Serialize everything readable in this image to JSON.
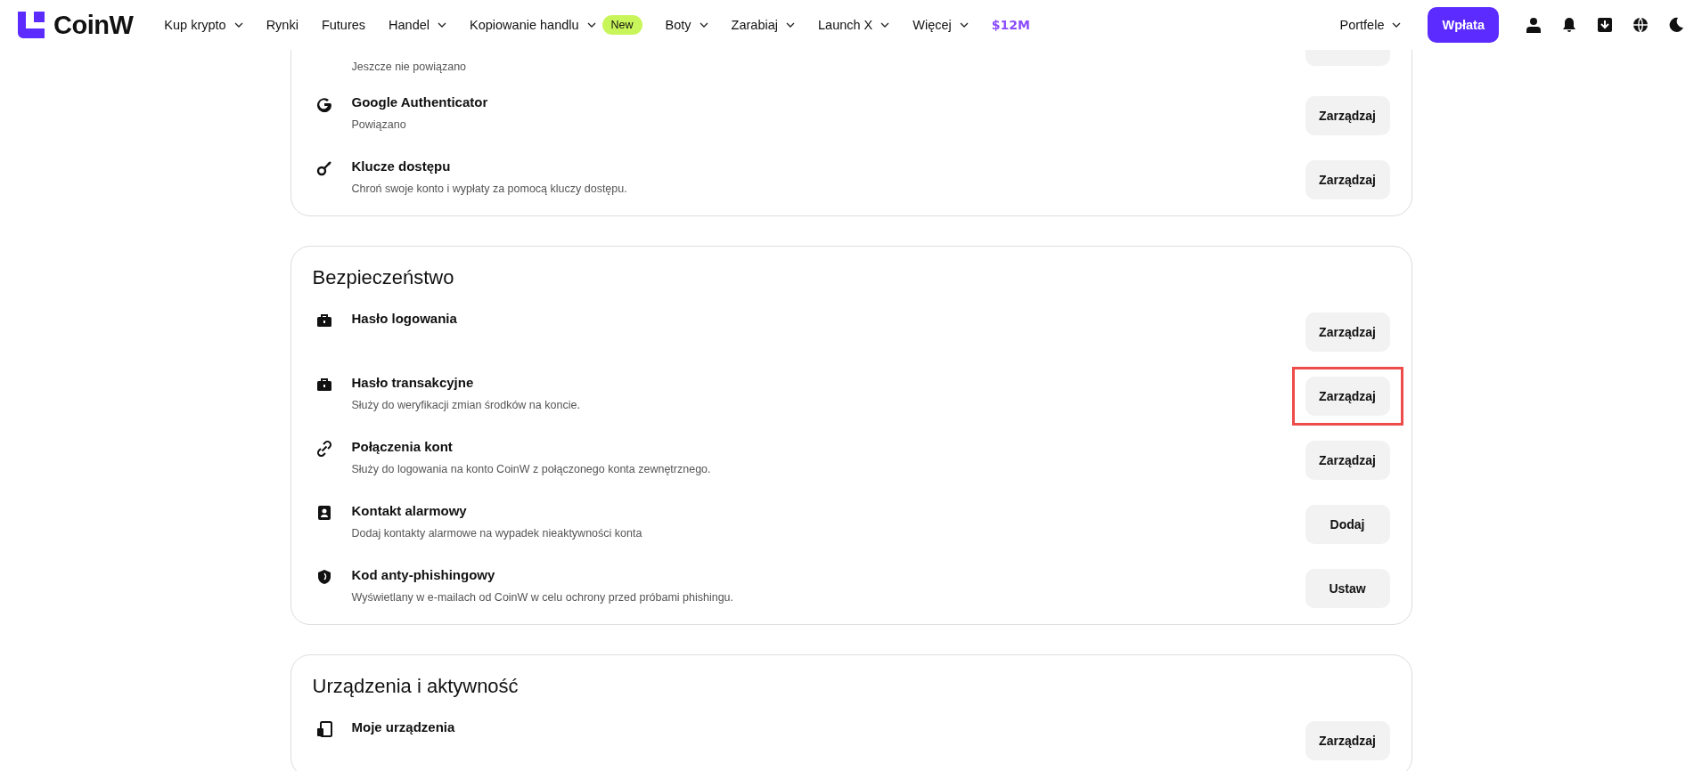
{
  "header": {
    "logo": "CoinW",
    "nav": [
      {
        "label": "Kup krypto",
        "caret": true
      },
      {
        "label": "Rynki",
        "caret": false
      },
      {
        "label": "Futures",
        "caret": false
      },
      {
        "label": "Handel",
        "caret": true
      },
      {
        "label": "Kopiowanie handlu",
        "caret": true,
        "badge": "New"
      },
      {
        "label": "Boty",
        "caret": true
      },
      {
        "label": "Zarabiaj",
        "caret": true
      },
      {
        "label": "Launch X",
        "caret": true
      },
      {
        "label": "Więcej",
        "caret": true
      }
    ],
    "promo": "$12M",
    "wallets": {
      "label": "Portfele",
      "caret": true
    },
    "deposit": "Wpłata"
  },
  "sections": [
    {
      "rows": [
        {
          "kind": "partial",
          "subtitle": "Jeszcze nie powiązano"
        },
        {
          "kind": "google",
          "title": "Google Authenticator",
          "subtitle": "Powiązano",
          "button": "Zarządzaj"
        },
        {
          "kind": "key",
          "title": "Klucze dostępu",
          "subtitle": "Chroń swoje konto i wypłaty za pomocą kluczy dostępu.",
          "button": "Zarządzaj"
        }
      ]
    },
    {
      "heading": "Bezpieczeństwo",
      "rows": [
        {
          "kind": "lock",
          "title": "Hasło logowania",
          "button": "Zarządzaj"
        },
        {
          "kind": "lock",
          "title": "Hasło transakcyjne",
          "subtitle": "Służy do weryfikacji zmian środków na koncie.",
          "button": "Zarządzaj",
          "highlighted": true
        },
        {
          "kind": "link",
          "title": "Połączenia kont",
          "subtitle": "Służy do logowania na konto CoinW z połączonego konta zewnętrznego.",
          "button": "Zarządzaj"
        },
        {
          "kind": "contact",
          "title": "Kontakt alarmowy",
          "subtitle": "Dodaj kontakty alarmowe na wypadek nieaktywności konta",
          "button": "Dodaj"
        },
        {
          "kind": "shield",
          "title": "Kod anty-phishingowy",
          "subtitle": "Wyświetlany w e-mailach od CoinW w celu ochrony przed próbami phishingu.",
          "button": "Ustaw"
        }
      ]
    },
    {
      "heading": "Urządzenia i aktywność",
      "rows": [
        {
          "kind": "device",
          "title": "Moje urządzenia",
          "button": "Zarządzaj"
        }
      ]
    }
  ]
}
